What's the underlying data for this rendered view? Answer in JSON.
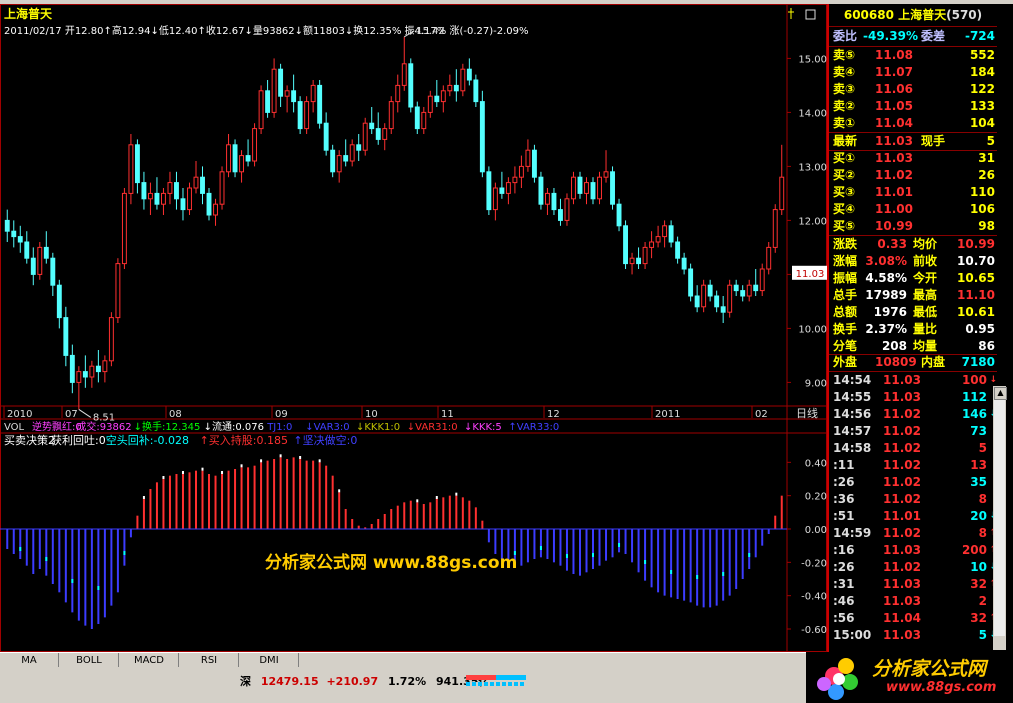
{
  "stock": {
    "code_name": "600680 上海普天",
    "code_suffix": "(570)",
    "name": "上海普天"
  },
  "quote_header": {
    "date": "2011/02/17",
    "open_label": "开",
    "open": "12.80",
    "high_label": "高",
    "high": "12.94",
    "low_label": "低",
    "low": "12.40",
    "close_label": "收",
    "close": "12.67",
    "vol_label": "量",
    "vol": "93862",
    "amt_label": "额",
    "amt": "11803",
    "turnover_label": "换",
    "turnover": "12.35%",
    "amplitude_label": "振",
    "amplitude": "4.17%",
    "change_label": "涨",
    "change": "(-0.27)-2.09%"
  },
  "price_axis": {
    "labels": [
      "15.00",
      "14.00",
      "13.00",
      "12.00",
      "11.00",
      "10.00",
      "9.00"
    ],
    "min": 8.6,
    "max": 15.6,
    "current": "11.03"
  },
  "annotations": {
    "high_mark": "15.42",
    "low_mark": "8.51"
  },
  "time_axis": {
    "labels": [
      "2010",
      "07",
      "08",
      "09",
      "10",
      "11",
      "12",
      "2011",
      "02"
    ],
    "period": "日线"
  },
  "vol_row": {
    "label": "VOL",
    "items": [
      {
        "text": "逆势飘红:0",
        "color": "#ff40ff"
      },
      {
        "text": "成交:93862",
        "color": "#ff40ff"
      },
      {
        "text": "↓换手:12.345",
        "color": "#00ff00"
      },
      {
        "text": "↓流通:0.076",
        "color": "#ffffff"
      },
      {
        "text": "TJ1:0",
        "color": "#4040ff"
      },
      {
        "text": "↓VAR3:0",
        "color": "#4040ff"
      },
      {
        "text": "↓KKK1:0",
        "color": "#c0c000"
      },
      {
        "text": "↓VAR31:0",
        "color": "#ff3030"
      },
      {
        "text": "↓KKK:5",
        "color": "#ff40ff"
      },
      {
        "text": "↑VAR33:0",
        "color": "#4040ff"
      }
    ]
  },
  "indicator_row": {
    "items": [
      {
        "text": "买卖决策2",
        "color": "#ffffff"
      },
      {
        "text": "获利回吐:0",
        "color": "#ffffff"
      },
      {
        "text": "空头回补:-0.028",
        "color": "#00ffff"
      },
      {
        "text": "↑买入持股:0.185",
        "color": "#ff3030"
      },
      {
        "text": "↑坚决做空:0",
        "color": "#4040ff"
      }
    ]
  },
  "ind_axis": {
    "labels": [
      "0.40",
      "0.20",
      "0.00",
      "-0.20",
      "-0.40",
      "-0.60"
    ]
  },
  "watermark": "分析家公式网 www.88gs.com",
  "tabs": [
    "MA",
    "BOLL",
    "MACD",
    "RSI",
    "DMI"
  ],
  "status": {
    "market": "深",
    "index": "12479.15",
    "change": "+210.97",
    "pct": "1.72%",
    "amount": "941.35亿"
  },
  "panel": {
    "weibi_label": "委比",
    "weibi": "-49.39%",
    "weicha_label": "委差",
    "weicha": "-724",
    "asks": [
      {
        "label": "卖⑤",
        "price": "11.08",
        "vol": "552"
      },
      {
        "label": "卖④",
        "price": "11.07",
        "vol": "184"
      },
      {
        "label": "卖③",
        "price": "11.06",
        "vol": "122"
      },
      {
        "label": "卖②",
        "price": "11.05",
        "vol": "133"
      },
      {
        "label": "卖①",
        "price": "11.04",
        "vol": "104"
      }
    ],
    "latest_label": "最新",
    "latest": "11.03",
    "now_hand_label": "现手",
    "now_hand": "5",
    "bids": [
      {
        "label": "买①",
        "price": "11.03",
        "vol": "31"
      },
      {
        "label": "买②",
        "price": "11.02",
        "vol": "26"
      },
      {
        "label": "买③",
        "price": "11.01",
        "vol": "110"
      },
      {
        "label": "买④",
        "price": "11.00",
        "vol": "106"
      },
      {
        "label": "买⑤",
        "price": "10.99",
        "vol": "98"
      }
    ],
    "stats": [
      {
        "l1": "涨跌",
        "v1": "0.33",
        "c1": "#ff3030",
        "l2": "均价",
        "v2": "10.99",
        "c2": "#ff3030"
      },
      {
        "l1": "涨幅",
        "v1": "3.08%",
        "c1": "#ff3030",
        "l2": "前收",
        "v2": "10.70",
        "c2": "#ffffff"
      },
      {
        "l1": "振幅",
        "v1": "4.58%",
        "c1": "#ffffff",
        "l2": "今开",
        "v2": "10.65",
        "c2": "#ffff00"
      },
      {
        "l1": "总手",
        "v1": "17989",
        "c1": "#ffffff",
        "l2": "最高",
        "v2": "11.10",
        "c2": "#ff3030"
      },
      {
        "l1": "总额",
        "v1": "1976",
        "c1": "#ffffff",
        "l2": "最低",
        "v2": "10.61",
        "c2": "#ffff00"
      },
      {
        "l1": "换手",
        "v1": "2.37%",
        "c1": "#ffffff",
        "l2": "量比",
        "v2": "0.95",
        "c2": "#ffffff"
      },
      {
        "l1": "分笔",
        "v1": "208",
        "c1": "#ffffff",
        "l2": "均量",
        "v2": "86",
        "c2": "#ffffff"
      }
    ],
    "outer_label": "外盘",
    "outer": "10809",
    "inner_label": "内盘",
    "inner": "7180",
    "ticks": [
      {
        "time": "14:54",
        "price": "11.03",
        "vol": "100",
        "arrow": "↓",
        "pc": "#ff3030",
        "vc": "#ff3030"
      },
      {
        "time": "14:55",
        "price": "11.03",
        "vol": "112",
        "arrow": "",
        "pc": "#ff3030",
        "vc": "#00ffff"
      },
      {
        "time": "14:56",
        "price": "11.02",
        "vol": "146",
        "arrow": "↓",
        "pc": "#ff3030",
        "vc": "#00ffff"
      },
      {
        "time": "14:57",
        "price": "11.02",
        "vol": "73",
        "arrow": "",
        "pc": "#ff3030",
        "vc": "#00ffff"
      },
      {
        "time": "14:58",
        "price": "11.02",
        "vol": "5",
        "arrow": "",
        "pc": "#ff3030",
        "vc": "#ff3030"
      },
      {
        "time": ":11",
        "price": "11.02",
        "vol": "13",
        "arrow": "",
        "pc": "#ff3030",
        "vc": "#ff3030"
      },
      {
        "time": ":26",
        "price": "11.02",
        "vol": "35",
        "arrow": "",
        "pc": "#ff3030",
        "vc": "#00ffff"
      },
      {
        "time": ":36",
        "price": "11.02",
        "vol": "8",
        "arrow": "",
        "pc": "#ff3030",
        "vc": "#ff3030"
      },
      {
        "time": ":51",
        "price": "11.01",
        "vol": "20",
        "arrow": "↓",
        "pc": "#ff3030",
        "vc": "#00ffff"
      },
      {
        "time": "14:59",
        "price": "11.02",
        "vol": "8",
        "arrow": "↑",
        "pc": "#ff3030",
        "vc": "#ff3030"
      },
      {
        "time": ":16",
        "price": "11.03",
        "vol": "200",
        "arrow": "↑",
        "pc": "#ff3030",
        "vc": "#ff3030"
      },
      {
        "time": ":26",
        "price": "11.02",
        "vol": "10",
        "arrow": "↓",
        "pc": "#ff3030",
        "vc": "#00ffff"
      },
      {
        "time": ":31",
        "price": "11.03",
        "vol": "32",
        "arrow": "↑",
        "pc": "#ff3030",
        "vc": "#ff3030"
      },
      {
        "time": ":46",
        "price": "11.03",
        "vol": "2",
        "arrow": "",
        "pc": "#ff3030",
        "vc": "#ff3030"
      },
      {
        "time": ":56",
        "price": "11.04",
        "vol": "32",
        "arrow": "↑",
        "pc": "#ff3030",
        "vc": "#ff3030"
      },
      {
        "time": "15:00",
        "price": "11.03",
        "vol": "5",
        "arrow": "↓",
        "pc": "#ff3030",
        "vc": "#00ffff"
      }
    ]
  },
  "logo": {
    "text": "分析家公式网",
    "url": "www.88gs.com"
  },
  "candles": [
    [
      12.0,
      12.2,
      11.6,
      11.8
    ],
    [
      11.8,
      12.0,
      11.5,
      11.7
    ],
    [
      11.7,
      11.9,
      11.4,
      11.6
    ],
    [
      11.6,
      11.8,
      11.2,
      11.3
    ],
    [
      11.3,
      11.5,
      10.8,
      11.0
    ],
    [
      11.0,
      11.6,
      10.9,
      11.5
    ],
    [
      11.5,
      11.8,
      11.2,
      11.3
    ],
    [
      11.3,
      11.4,
      10.6,
      10.8
    ],
    [
      10.8,
      10.9,
      10.0,
      10.2
    ],
    [
      10.2,
      10.4,
      9.3,
      9.5
    ],
    [
      9.5,
      9.7,
      8.8,
      9.0
    ],
    [
      9.0,
      9.3,
      8.5,
      9.2
    ],
    [
      9.2,
      9.5,
      8.9,
      9.1
    ],
    [
      9.1,
      9.4,
      8.9,
      9.3
    ],
    [
      9.3,
      9.6,
      9.0,
      9.2
    ],
    [
      9.2,
      9.5,
      9.0,
      9.4
    ],
    [
      9.4,
      10.3,
      9.3,
      10.2
    ],
    [
      10.2,
      11.3,
      10.1,
      11.2
    ],
    [
      11.2,
      12.6,
      11.1,
      12.5
    ],
    [
      12.5,
      13.6,
      12.3,
      13.4
    ],
    [
      13.4,
      13.5,
      12.5,
      12.7
    ],
    [
      12.7,
      12.9,
      12.2,
      12.4
    ],
    [
      12.4,
      12.7,
      12.1,
      12.5
    ],
    [
      12.5,
      12.8,
      12.2,
      12.3
    ],
    [
      12.3,
      12.6,
      12.1,
      12.5
    ],
    [
      12.5,
      12.9,
      12.3,
      12.7
    ],
    [
      12.7,
      12.9,
      12.2,
      12.4
    ],
    [
      12.4,
      12.6,
      12.0,
      12.2
    ],
    [
      12.2,
      12.7,
      12.1,
      12.6
    ],
    [
      12.6,
      13.1,
      12.5,
      12.8
    ],
    [
      12.8,
      13.0,
      12.3,
      12.5
    ],
    [
      12.5,
      12.6,
      12.0,
      12.1
    ],
    [
      12.1,
      12.4,
      11.9,
      12.3
    ],
    [
      12.3,
      13.0,
      12.2,
      12.9
    ],
    [
      12.9,
      13.6,
      12.8,
      13.4
    ],
    [
      13.4,
      13.5,
      12.8,
      12.9
    ],
    [
      12.9,
      13.3,
      12.7,
      13.2
    ],
    [
      13.2,
      13.5,
      13.0,
      13.1
    ],
    [
      13.1,
      13.8,
      13.0,
      13.7
    ],
    [
      13.7,
      14.5,
      13.6,
      14.4
    ],
    [
      14.4,
      14.6,
      13.9,
      14.0
    ],
    [
      14.0,
      15.0,
      13.9,
      14.8
    ],
    [
      14.8,
      14.9,
      14.1,
      14.3
    ],
    [
      14.3,
      14.5,
      14.0,
      14.4
    ],
    [
      14.4,
      14.7,
      14.0,
      14.2
    ],
    [
      14.2,
      14.3,
      13.6,
      13.7
    ],
    [
      13.7,
      14.3,
      13.6,
      14.2
    ],
    [
      14.2,
      14.6,
      14.0,
      14.5
    ],
    [
      14.5,
      14.6,
      13.7,
      13.8
    ],
    [
      13.8,
      14.0,
      13.2,
      13.3
    ],
    [
      13.3,
      13.4,
      12.8,
      12.9
    ],
    [
      12.9,
      13.3,
      12.7,
      13.2
    ],
    [
      13.2,
      13.5,
      13.0,
      13.1
    ],
    [
      13.1,
      13.5,
      13.0,
      13.4
    ],
    [
      13.4,
      13.6,
      13.1,
      13.3
    ],
    [
      13.3,
      13.9,
      13.2,
      13.8
    ],
    [
      13.8,
      14.1,
      13.6,
      13.7
    ],
    [
      13.7,
      14.0,
      13.4,
      13.5
    ],
    [
      13.5,
      13.8,
      13.3,
      13.7
    ],
    [
      13.7,
      14.3,
      13.6,
      14.2
    ],
    [
      14.2,
      14.7,
      14.0,
      14.5
    ],
    [
      14.5,
      15.4,
      14.4,
      14.9
    ],
    [
      14.9,
      15.0,
      14.0,
      14.1
    ],
    [
      14.1,
      14.2,
      13.6,
      13.7
    ],
    [
      13.7,
      14.1,
      13.6,
      14.0
    ],
    [
      14.0,
      14.4,
      13.9,
      14.3
    ],
    [
      14.3,
      14.6,
      14.1,
      14.2
    ],
    [
      14.2,
      14.5,
      14.0,
      14.4
    ],
    [
      14.4,
      14.7,
      14.3,
      14.5
    ],
    [
      14.5,
      14.8,
      14.2,
      14.4
    ],
    [
      14.4,
      14.9,
      14.3,
      14.8
    ],
    [
      14.8,
      15.0,
      14.5,
      14.6
    ],
    [
      14.6,
      14.7,
      14.1,
      14.2
    ],
    [
      14.2,
      14.4,
      12.8,
      12.9
    ],
    [
      12.9,
      13.0,
      12.1,
      12.2
    ],
    [
      12.2,
      12.7,
      12.0,
      12.6
    ],
    [
      12.6,
      12.9,
      12.4,
      12.5
    ],
    [
      12.5,
      12.8,
      12.3,
      12.7
    ],
    [
      12.7,
      13.0,
      12.5,
      12.8
    ],
    [
      12.8,
      13.2,
      12.6,
      13.0
    ],
    [
      13.0,
      13.5,
      12.9,
      13.3
    ],
    [
      13.3,
      13.4,
      12.7,
      12.8
    ],
    [
      12.8,
      12.9,
      12.2,
      12.3
    ],
    [
      12.3,
      12.6,
      12.1,
      12.5
    ],
    [
      12.5,
      12.6,
      12.1,
      12.2
    ],
    [
      12.2,
      12.4,
      11.9,
      12.0
    ],
    [
      12.0,
      12.5,
      11.9,
      12.4
    ],
    [
      12.4,
      12.9,
      12.3,
      12.8
    ],
    [
      12.8,
      12.9,
      12.4,
      12.5
    ],
    [
      12.5,
      12.8,
      12.3,
      12.7
    ],
    [
      12.7,
      12.8,
      12.3,
      12.4
    ],
    [
      12.4,
      12.9,
      12.3,
      12.8
    ],
    [
      12.8,
      13.3,
      12.7,
      12.9
    ],
    [
      12.9,
      13.0,
      12.2,
      12.3
    ],
    [
      12.3,
      12.4,
      11.8,
      11.9
    ],
    [
      11.9,
      12.0,
      11.1,
      11.2
    ],
    [
      11.2,
      11.4,
      11.0,
      11.3
    ],
    [
      11.3,
      11.5,
      11.1,
      11.2
    ],
    [
      11.2,
      11.6,
      11.1,
      11.5
    ],
    [
      11.5,
      11.8,
      11.3,
      11.6
    ],
    [
      11.6,
      11.9,
      11.5,
      11.7
    ],
    [
      11.7,
      12.0,
      11.5,
      11.9
    ],
    [
      11.9,
      12.0,
      11.5,
      11.6
    ],
    [
      11.6,
      11.7,
      11.2,
      11.3
    ],
    [
      11.3,
      11.4,
      11.0,
      11.1
    ],
    [
      11.1,
      11.2,
      10.5,
      10.6
    ],
    [
      10.6,
      10.8,
      10.3,
      10.4
    ],
    [
      10.4,
      10.9,
      10.3,
      10.8
    ],
    [
      10.8,
      10.9,
      10.5,
      10.6
    ],
    [
      10.6,
      10.7,
      10.3,
      10.4
    ],
    [
      10.4,
      10.6,
      10.1,
      10.3
    ],
    [
      10.3,
      10.9,
      10.2,
      10.8
    ],
    [
      10.8,
      10.9,
      10.6,
      10.7
    ],
    [
      10.7,
      10.8,
      10.5,
      10.6
    ],
    [
      10.6,
      10.9,
      10.5,
      10.8
    ],
    [
      10.8,
      11.1,
      10.6,
      10.7
    ],
    [
      10.7,
      11.2,
      10.6,
      11.1
    ],
    [
      11.1,
      11.6,
      11.0,
      11.5
    ],
    [
      11.5,
      12.3,
      11.4,
      12.2
    ],
    [
      12.2,
      13.4,
      12.1,
      12.8
    ]
  ],
  "indicator": [
    -0.12,
    -0.15,
    -0.18,
    -0.22,
    -0.27,
    -0.24,
    -0.28,
    -0.33,
    -0.38,
    -0.44,
    -0.5,
    -0.55,
    -0.58,
    -0.6,
    -0.57,
    -0.53,
    -0.46,
    -0.38,
    -0.22,
    -0.05,
    0.08,
    0.18,
    0.24,
    0.28,
    0.3,
    0.32,
    0.33,
    0.33,
    0.34,
    0.35,
    0.35,
    0.33,
    0.32,
    0.33,
    0.35,
    0.36,
    0.37,
    0.37,
    0.38,
    0.4,
    0.41,
    0.42,
    0.43,
    0.42,
    0.43,
    0.42,
    0.41,
    0.41,
    0.4,
    0.38,
    0.32,
    0.22,
    0.12,
    0.06,
    0.02,
    0.01,
    0.03,
    0.06,
    0.09,
    0.12,
    0.14,
    0.16,
    0.17,
    0.16,
    0.15,
    0.16,
    0.18,
    0.19,
    0.2,
    0.2,
    0.19,
    0.17,
    0.13,
    0.05,
    -0.08,
    -0.15,
    -0.18,
    -0.2,
    -0.22,
    -0.22,
    -0.2,
    -0.18,
    -0.17,
    -0.18,
    -0.2,
    -0.22,
    -0.25,
    -0.27,
    -0.28,
    -0.26,
    -0.24,
    -0.22,
    -0.19,
    -0.17,
    -0.14,
    -0.15,
    -0.2,
    -0.26,
    -0.31,
    -0.35,
    -0.38,
    -0.4,
    -0.41,
    -0.42,
    -0.43,
    -0.44,
    -0.46,
    -0.47,
    -0.47,
    -0.46,
    -0.43,
    -0.4,
    -0.36,
    -0.3,
    -0.24,
    -0.17,
    -0.1,
    -0.03,
    0.08,
    0.2
  ]
}
